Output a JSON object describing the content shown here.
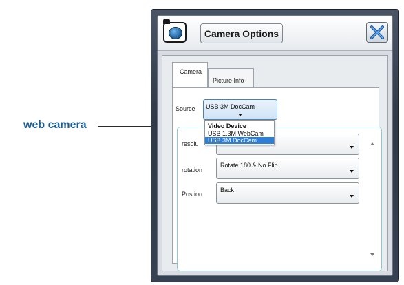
{
  "callout": {
    "label": "web camera"
  },
  "window": {
    "title": "Camera Options",
    "camera_icon": "camera-icon",
    "close_icon": "close-icon"
  },
  "tabs": [
    {
      "label": "Camera",
      "active": true
    },
    {
      "label": "Picture Info",
      "active": false
    }
  ],
  "source": {
    "label": "Source",
    "selected": "USB 3M DocCam"
  },
  "dropdown": {
    "header": "Video Device",
    "items": [
      {
        "label": "USB 1.3M WebCam",
        "selected": false
      },
      {
        "label": "USB 3M DocCam",
        "selected": true
      }
    ]
  },
  "fields": [
    {
      "label": "resolu",
      "value": ""
    },
    {
      "label": "rotation",
      "value": "Rotate 180 & No Flip"
    },
    {
      "label": "Postion",
      "value": "Back"
    }
  ],
  "colors": {
    "callout_text": "#1b5e93",
    "window_dark": "#2f3947",
    "selection": "#2e7dd6",
    "accent_border": "#8fc7cf"
  }
}
